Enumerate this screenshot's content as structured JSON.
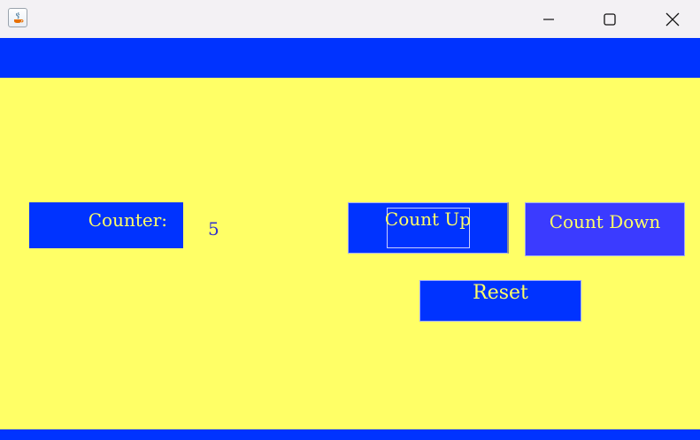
{
  "window": {
    "title": "",
    "controls": {
      "minimize_icon": "minimize-icon",
      "maximize_icon": "maximize-icon",
      "close_icon": "close-icon"
    },
    "colors": {
      "background": "#ffff66",
      "band": "#0033ff",
      "text": "#ffff66",
      "value_text": "#3333cc",
      "count_down_bg": "#3b3bff"
    }
  },
  "counter": {
    "label": "Counter:",
    "value": "5"
  },
  "buttons": {
    "count_up": "Count Up",
    "count_down": "Count Down",
    "reset": "Reset"
  }
}
